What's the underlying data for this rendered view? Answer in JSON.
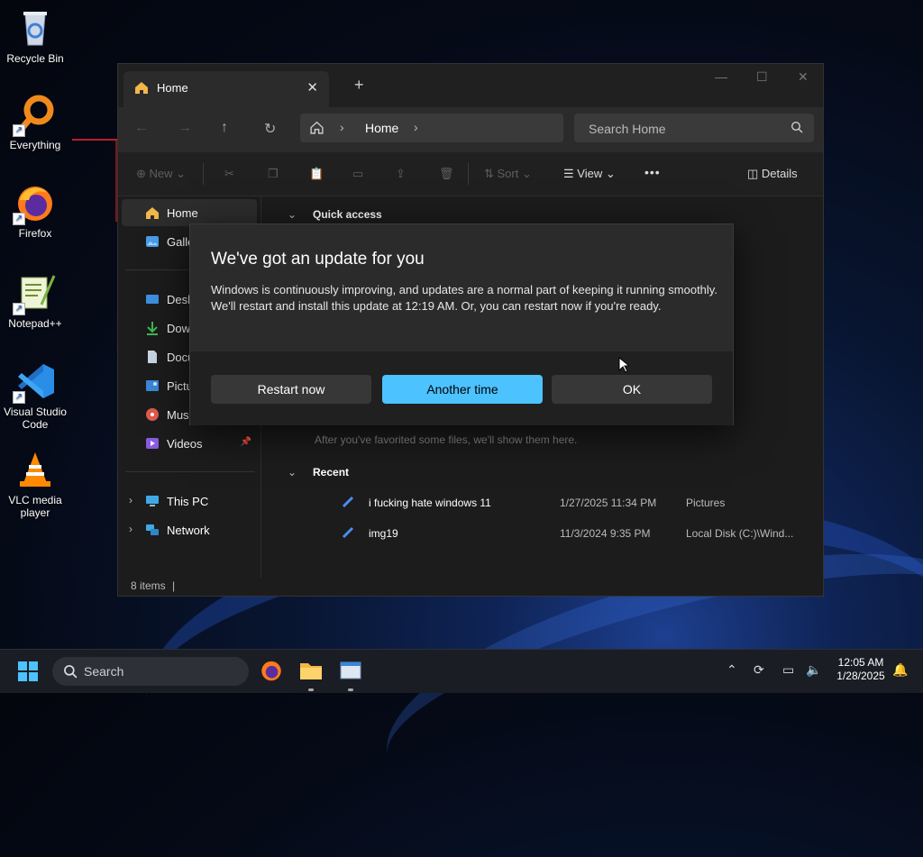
{
  "desktop": {
    "icons": [
      {
        "label": "Recycle Bin"
      },
      {
        "label": "Everything"
      },
      {
        "label": "Firefox"
      },
      {
        "label": "Notepad++"
      },
      {
        "label": "Visual Studio Code"
      },
      {
        "label": "VLC media player"
      }
    ]
  },
  "explorer": {
    "tab_title": "Home",
    "address": {
      "crumb": "Home"
    },
    "search": {
      "placeholder": "Search Home"
    },
    "toolbar": {
      "new": "New",
      "sort": "Sort",
      "view": "View",
      "more": "•••",
      "details": "Details"
    },
    "nav": {
      "items": [
        {
          "label": "Home"
        },
        {
          "label": "Gallery"
        },
        {
          "label": "Desktop"
        },
        {
          "label": "Downloads"
        },
        {
          "label": "Documents"
        },
        {
          "label": "Pictures"
        },
        {
          "label": "Music"
        },
        {
          "label": "Videos"
        },
        {
          "label": "This PC"
        },
        {
          "label": "Network"
        }
      ]
    },
    "main": {
      "quick_access": "Quick access",
      "favorites_hint": "After you've favorited some files, we'll show them here.",
      "recent": "Recent",
      "files": [
        {
          "name": "i fucking hate windows 11",
          "date": "1/27/2025 11:34 PM",
          "location": "Pictures"
        },
        {
          "name": "img19",
          "date": "11/3/2024 9:35 PM",
          "location": "Local Disk (C:)\\Wind..."
        }
      ]
    },
    "status": {
      "items": "8 items",
      "caret": "|"
    }
  },
  "dialog": {
    "title": "We've got an update for you",
    "body": "Windows is continuously improving, and updates are a normal part of keeping it running smoothly. We'll restart and install this update at 12:19 AM. Or, you can restart now if you're ready.",
    "buttons": {
      "restart": "Restart now",
      "later": "Another time",
      "ok": "OK"
    },
    "accent_color": "#4cc2ff"
  },
  "taskbar": {
    "search_label": "Search",
    "clock": {
      "time": "12:05 AM",
      "date": "1/28/2025"
    }
  }
}
